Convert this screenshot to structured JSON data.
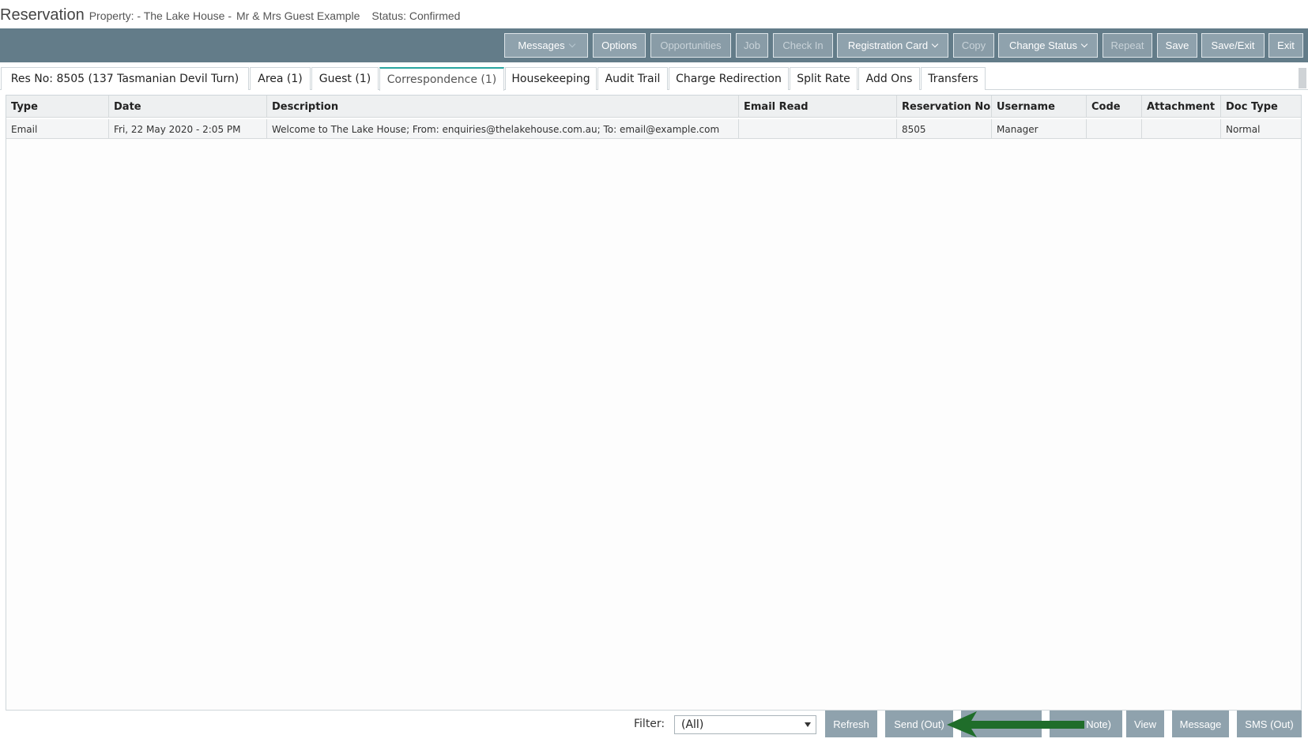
{
  "header": {
    "title": "Reservation",
    "property": "Property: - The Lake House -",
    "guest": "Mr & Mrs Guest Example",
    "status": "Status: Confirmed"
  },
  "toolbar": {
    "buttons": [
      {
        "label": "Messages",
        "enabled": true,
        "dropdown": true
      },
      {
        "label": "Options",
        "enabled": true
      },
      {
        "label": "Opportunities",
        "enabled": false
      },
      {
        "label": "Job",
        "enabled": false
      },
      {
        "label": "Check In",
        "enabled": false
      },
      {
        "label": "Registration Card",
        "enabled": true,
        "dropdown": true
      },
      {
        "label": "Copy",
        "enabled": false
      },
      {
        "label": "Change Status",
        "enabled": true,
        "dropdown": true
      },
      {
        "label": "Repeat",
        "enabled": false
      },
      {
        "label": "Save",
        "enabled": true
      },
      {
        "label": "Save/Exit",
        "enabled": true
      },
      {
        "label": "Exit",
        "enabled": true
      }
    ]
  },
  "tabs": [
    {
      "label": "Res No: 8505 (137 Tasmanian Devil Turn)"
    },
    {
      "label": "Area (1)"
    },
    {
      "label": "Guest (1)"
    },
    {
      "label": "Correspondence (1)",
      "active": true
    },
    {
      "label": "Housekeeping"
    },
    {
      "label": "Audit Trail"
    },
    {
      "label": "Charge Redirection"
    },
    {
      "label": "Split Rate"
    },
    {
      "label": "Add Ons"
    },
    {
      "label": "Transfers"
    }
  ],
  "table": {
    "columns": [
      "Type",
      "Date",
      "Description",
      "Email Read",
      "Reservation No",
      "Username",
      "Code",
      "Attachment",
      "Doc Type"
    ],
    "rows": [
      [
        "Email",
        "Fri, 22 May 2020 - 2:05 PM",
        "Welcome to The Lake House; From: enquiries@thelakehouse.com.au; To: email@example.com",
        "",
        "8505",
        "Manager",
        "",
        "",
        "Normal"
      ]
    ]
  },
  "footer": {
    "filter_label": "Filter:",
    "filter_value": "(All)",
    "buttons": [
      {
        "label": "Refresh"
      },
      {
        "label": "Send (Out)"
      },
      {
        "label": ""
      },
      {
        "label": "Note)"
      },
      {
        "label": "View"
      },
      {
        "label": "Message"
      },
      {
        "label": "SMS (Out)"
      }
    ]
  },
  "colors": {
    "toolbar_bg": "#637c89",
    "button_bg": "#8fa2ad",
    "active_tab_accent": "#2aa5a0",
    "arrow": "#1f6d2a"
  }
}
